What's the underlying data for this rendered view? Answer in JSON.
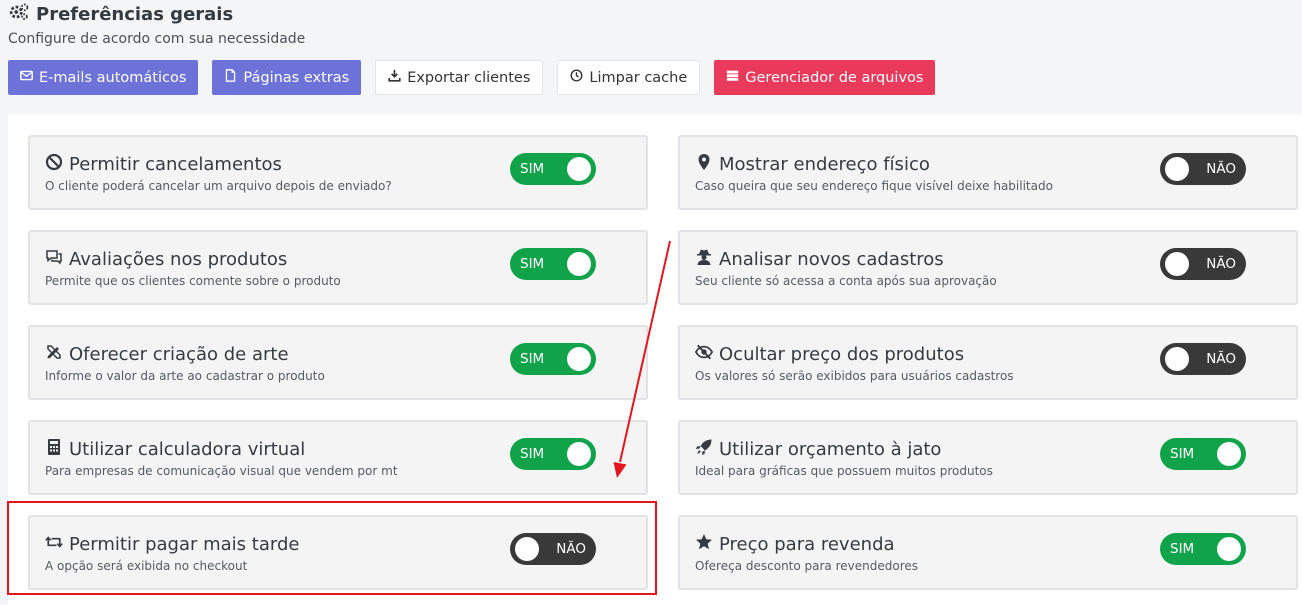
{
  "header": {
    "title": "Preferências gerais",
    "subtitle": "Configure de acordo com sua necessidade"
  },
  "toolbar": {
    "buttons": [
      {
        "label": "E-mails automáticos",
        "icon": "envelope-icon",
        "style": "indigo"
      },
      {
        "label": "Páginas extras",
        "icon": "file-icon",
        "style": "indigo"
      },
      {
        "label": "Exportar clientes",
        "icon": "download-icon",
        "style": "white"
      },
      {
        "label": "Limpar cache",
        "icon": "clock-icon",
        "style": "white"
      },
      {
        "label": "Gerenciador de arquivos",
        "icon": "database-icon",
        "style": "red"
      }
    ]
  },
  "settings": {
    "left": [
      {
        "title": "Permitir cancelamentos",
        "desc": "O cliente poderá cancelar um arquivo depois de enviado?",
        "state": "SIM",
        "icon": "ban-icon"
      },
      {
        "title": "Avaliações nos produtos",
        "desc": "Permite que os clientes comente sobre o produto",
        "state": "SIM",
        "icon": "comments-icon"
      },
      {
        "title": "Oferecer criação de arte",
        "desc": "Informe o valor da arte ao cadastrar o produto",
        "state": "SIM",
        "icon": "pencil-ruler-icon"
      },
      {
        "title": "Utilizar calculadora virtual",
        "desc": "Para empresas de comunicação visual que vendem por mt",
        "state": "SIM",
        "icon": "calculator-icon"
      },
      {
        "title": "Permitir pagar mais tarde",
        "desc": "A opção será exibida no checkout",
        "state": "NÃO",
        "icon": "retweet-icon"
      }
    ],
    "right": [
      {
        "title": "Mostrar endereço físico",
        "desc": "Caso queira que seu endereço fique visível deixe habilitado",
        "state": "NÃO",
        "icon": "map-marker-icon"
      },
      {
        "title": "Analisar novos cadastros",
        "desc": "Seu cliente só acessa a conta após sua aprovação",
        "state": "NÃO",
        "icon": "user-secret-icon"
      },
      {
        "title": "Ocultar preço dos produtos",
        "desc": "Os valores só serão exibidos para usuários cadastros",
        "state": "NÃO",
        "icon": "eye-slash-icon"
      },
      {
        "title": "Utilizar orçamento à jato",
        "desc": "Ideal para gráficas que possuem muitos produtos",
        "state": "SIM",
        "icon": "rocket-icon"
      },
      {
        "title": "Preço para revenda",
        "desc": "Ofereça desconto para revendedores",
        "state": "SIM",
        "icon": "star-icon"
      }
    ]
  },
  "colors": {
    "toggle_on": "#10a34a",
    "toggle_off": "#393939",
    "annotation": "#e2161f"
  }
}
